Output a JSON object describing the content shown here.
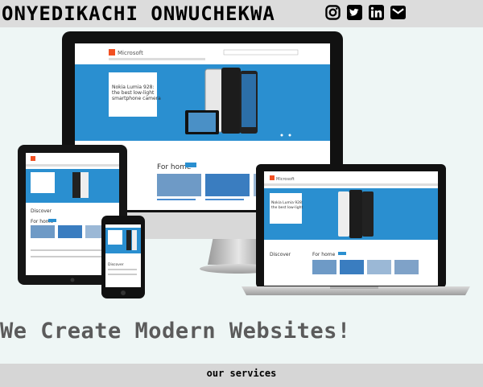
{
  "header": {
    "brand_name": "ONYEDIKACHI ONWUCHEKWA",
    "social_links": [
      {
        "name": "instagram",
        "icon": "instagram-icon"
      },
      {
        "name": "twitter",
        "icon": "twitter-icon"
      },
      {
        "name": "linkedin",
        "icon": "linkedin-icon"
      },
      {
        "name": "email",
        "icon": "email-icon"
      }
    ]
  },
  "hero": {
    "image_alt": "Responsive website shown on desktop, laptop, tablet and phone",
    "screen_text": {
      "microsoft": "Microsoft",
      "nokia": "Nokia Lumia 928: the best low-light smartphone camera",
      "for_home": "For home",
      "discover": "Discover"
    }
  },
  "main": {
    "headline": "We Create Modern Websites!"
  },
  "footer": {
    "services_label": "our services"
  },
  "colors": {
    "background": "#eef6f5",
    "header_bg": "#dcdcdc",
    "footer_bg": "#d6d6d6",
    "headline": "#5b5b5b",
    "screen_blue": "#2a8fd0"
  }
}
